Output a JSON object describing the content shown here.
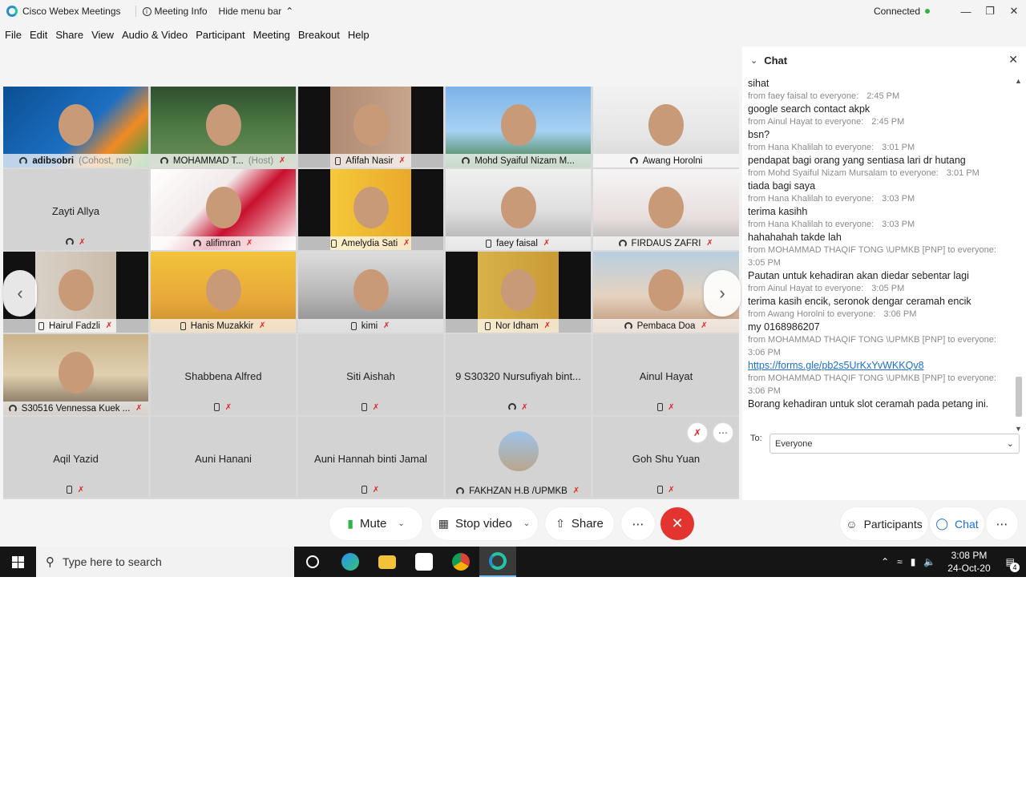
{
  "window": {
    "app_title": "Cisco Webex Meetings",
    "meeting_info": "Meeting Info",
    "hide_menu_bar": "Hide menu bar",
    "status": "Connected"
  },
  "menu": [
    "File",
    "Edit",
    "Share",
    "View",
    "Audio & Video",
    "Participant",
    "Meeting",
    "Breakout",
    "Help"
  ],
  "tiles": [
    {
      "name": "adibsobri",
      "role": "(Cohost, me)",
      "video": true,
      "audio": "headset",
      "muted": false,
      "selected": true
    },
    {
      "name": "MOHAMMAD T...",
      "role": "(Host)",
      "video": true,
      "audio": "headset",
      "muted": true
    },
    {
      "name": "Afifah Nasir",
      "video": true,
      "audio": "phone",
      "muted": true
    },
    {
      "name": "Mohd Syaiful Nizam M...",
      "video": true,
      "audio": "headset",
      "muted": false
    },
    {
      "name": "Awang Horolni",
      "video": true,
      "audio": "headset",
      "muted": false
    },
    {
      "name": "Zayti Allya",
      "video": false,
      "audio": "headset",
      "muted": true
    },
    {
      "name": "alifimran",
      "video": true,
      "audio": "headset",
      "muted": true
    },
    {
      "name": "Amelydia Sati",
      "video": true,
      "audio": "phone",
      "muted": true
    },
    {
      "name": "faey faisal",
      "video": true,
      "audio": "phone",
      "muted": true
    },
    {
      "name": "FIRDAUS ZAFRI",
      "video": true,
      "audio": "headset",
      "muted": true
    },
    {
      "name": "Hairul Fadzli",
      "video": true,
      "audio": "phone",
      "muted": true
    },
    {
      "name": "Hanis Muzakkir",
      "video": true,
      "audio": "phone",
      "muted": true
    },
    {
      "name": "kimi",
      "video": true,
      "audio": "phone",
      "muted": true
    },
    {
      "name": "Nor Idham",
      "video": true,
      "audio": "phone",
      "muted": true
    },
    {
      "name": "Pembaca Doa",
      "video": true,
      "audio": "headset",
      "muted": true
    },
    {
      "name": "S30516 Vennessa Kuek ...",
      "video": true,
      "audio": "headset",
      "muted": true
    },
    {
      "name": "Shabbena Alfred",
      "video": false,
      "audio": "phone",
      "muted": true
    },
    {
      "name": "Siti Aishah",
      "video": false,
      "audio": "phone",
      "muted": true
    },
    {
      "name": "9 S30320 Nursufiyah bint...",
      "video": false,
      "audio": "headset",
      "muted": true
    },
    {
      "name": "Ainul Hayat",
      "video": false,
      "audio": "phone",
      "muted": true
    },
    {
      "name": "Aqil Yazid",
      "video": false,
      "audio": "phone",
      "muted": true
    },
    {
      "name": "Auni Hanani",
      "video": false,
      "audio": "",
      "muted": false
    },
    {
      "name": "Auni Hannah binti Jamal",
      "video": false,
      "audio": "phone",
      "muted": true
    },
    {
      "name": "FAKHZAN H.B /UPMKB",
      "video": false,
      "avatar": true,
      "audio": "headset",
      "muted": true
    },
    {
      "name": "Goh Shu Yuan",
      "video": false,
      "audio": "phone",
      "muted": true
    }
  ],
  "chat": {
    "title": "Chat",
    "to_label": "To:",
    "to_value": "Everyone",
    "messages": [
      {
        "text": "sihat",
        "meta": "from faey faisal to everyone:",
        "time": "2:45 PM"
      },
      {
        "text": "google search contact akpk",
        "meta": "from Ainul Hayat to everyone:",
        "time": "2:45 PM"
      },
      {
        "text": "bsn?",
        "meta": "from Hana Khalilah to everyone:",
        "time": "3:01 PM"
      },
      {
        "text": "pendapat bagi orang yang sentiasa lari dr hutang",
        "meta": "from Mohd Syaiful Nizam Mursalam to everyone:",
        "time": "3:01 PM"
      },
      {
        "text": "tiada bagi saya",
        "meta": "from Hana Khalilah to everyone:",
        "time": "3:03 PM"
      },
      {
        "text": " terima kasihh",
        "meta": "from Hana Khalilah to everyone:",
        "time": "3:03 PM"
      },
      {
        "text": "hahahahah takde lah",
        "meta": "from MOHAMMAD THAQIF TONG \\UPMKB [PNP] to everyone:",
        "time": "3:05 PM",
        "time_newline": true
      },
      {
        "text": "Pautan untuk kehadiran akan diedar sebentar lagi",
        "meta": "from Ainul Hayat to everyone:",
        "time": "3:05 PM"
      },
      {
        "text": "terima kasih encik, seronok dengar ceramah encik",
        "meta": "from Awang Horolni to everyone:",
        "time": "3:06 PM"
      },
      {
        "text": "my 0168986207",
        "meta": "from MOHAMMAD THAQIF TONG \\UPMKB [PNP] to everyone:",
        "time": "3:06 PM",
        "time_newline": true
      },
      {
        "text": "https://forms.gle/pb2s5UrKxYvWKKQv8",
        "link": true,
        "meta": "from MOHAMMAD THAQIF TONG \\UPMKB [PNP] to everyone:",
        "time": "3:06 PM",
        "time_newline": true
      },
      {
        "text": "Borang kehadiran untuk slot ceramah pada petang ini.",
        "meta": "",
        "time": ""
      }
    ]
  },
  "controls": {
    "mute": "Mute",
    "stop_video": "Stop video",
    "share": "Share",
    "more": "⋯",
    "end": "✕",
    "participants": "Participants",
    "chat": "Chat"
  },
  "taskbar": {
    "search_placeholder": "Type here to search",
    "time": "3:08 PM",
    "date": "24-Oct-20",
    "notifications": "4"
  }
}
